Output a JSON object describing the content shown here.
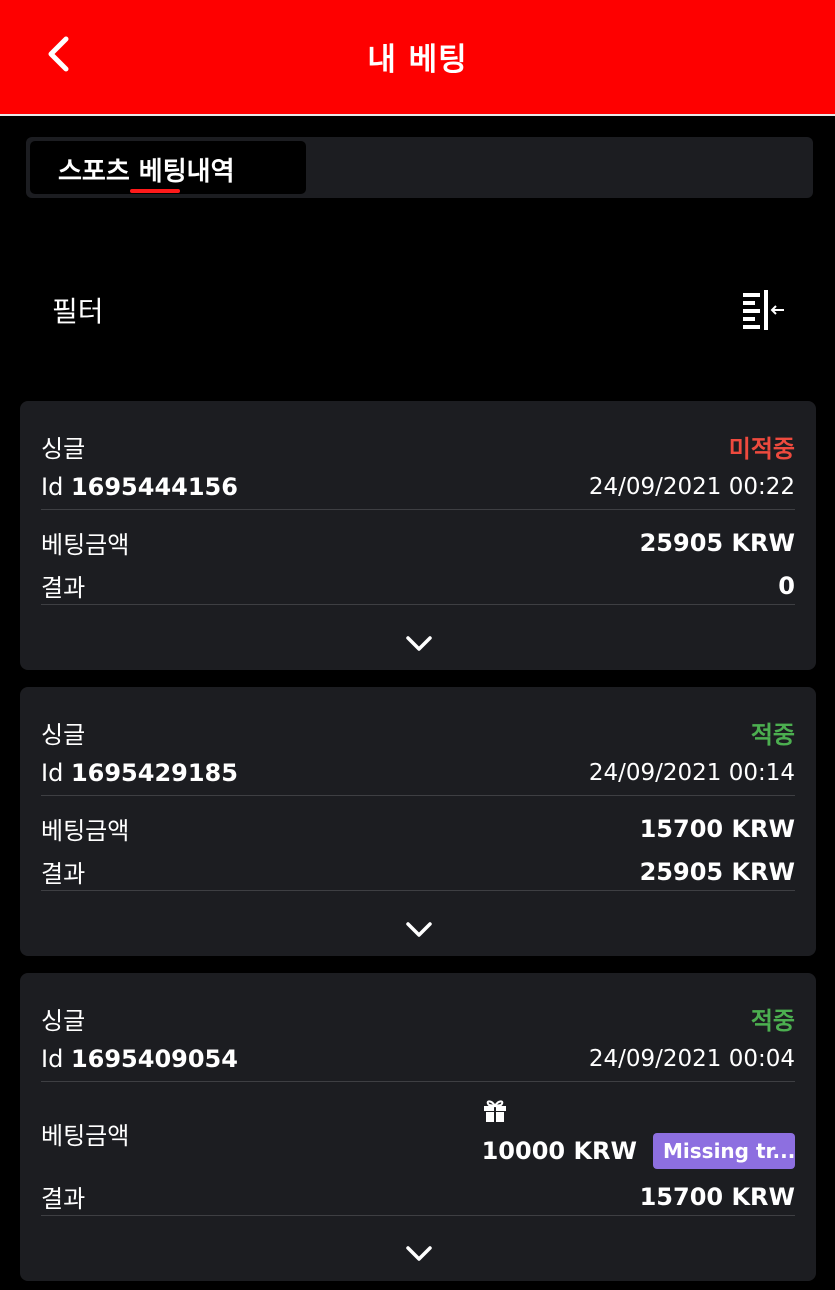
{
  "header": {
    "title": "내 베팅"
  },
  "tabs": [
    {
      "label": "스포츠 베팅내역"
    }
  ],
  "filter": {
    "label": "필터"
  },
  "bets": [
    {
      "type": "싱글",
      "status": "미적중",
      "id_label": "Id",
      "id": "1695444156",
      "datetime": "24/09/2021 00:22",
      "stake_label": "베팅금액",
      "stake": "25905 KRW",
      "result_label": "결과",
      "result": "0"
    },
    {
      "type": "싱글",
      "status": "적중",
      "id_label": "Id",
      "id": "1695429185",
      "datetime": "24/09/2021 00:14",
      "stake_label": "베팅금액",
      "stake": "15700 KRW",
      "result_label": "결과",
      "result": "25905 KRW"
    },
    {
      "type": "싱글",
      "status": "적중",
      "id_label": "Id",
      "id": "1695409054",
      "datetime": "24/09/2021 00:04",
      "stake_label": "베팅금액",
      "stake": "10000 KRW",
      "stake_tag": "Missing tr...",
      "result_label": "결과",
      "result": "15700 KRW"
    }
  ],
  "colors": {
    "header": "#fe0000",
    "lose": "#ee4a3e",
    "win": "#4caf50",
    "tag": "#8d6fe0"
  },
  "icons": [
    "chevron-left-icon",
    "filter-collapse-icon",
    "chevron-down-icon",
    "gift-icon"
  ]
}
